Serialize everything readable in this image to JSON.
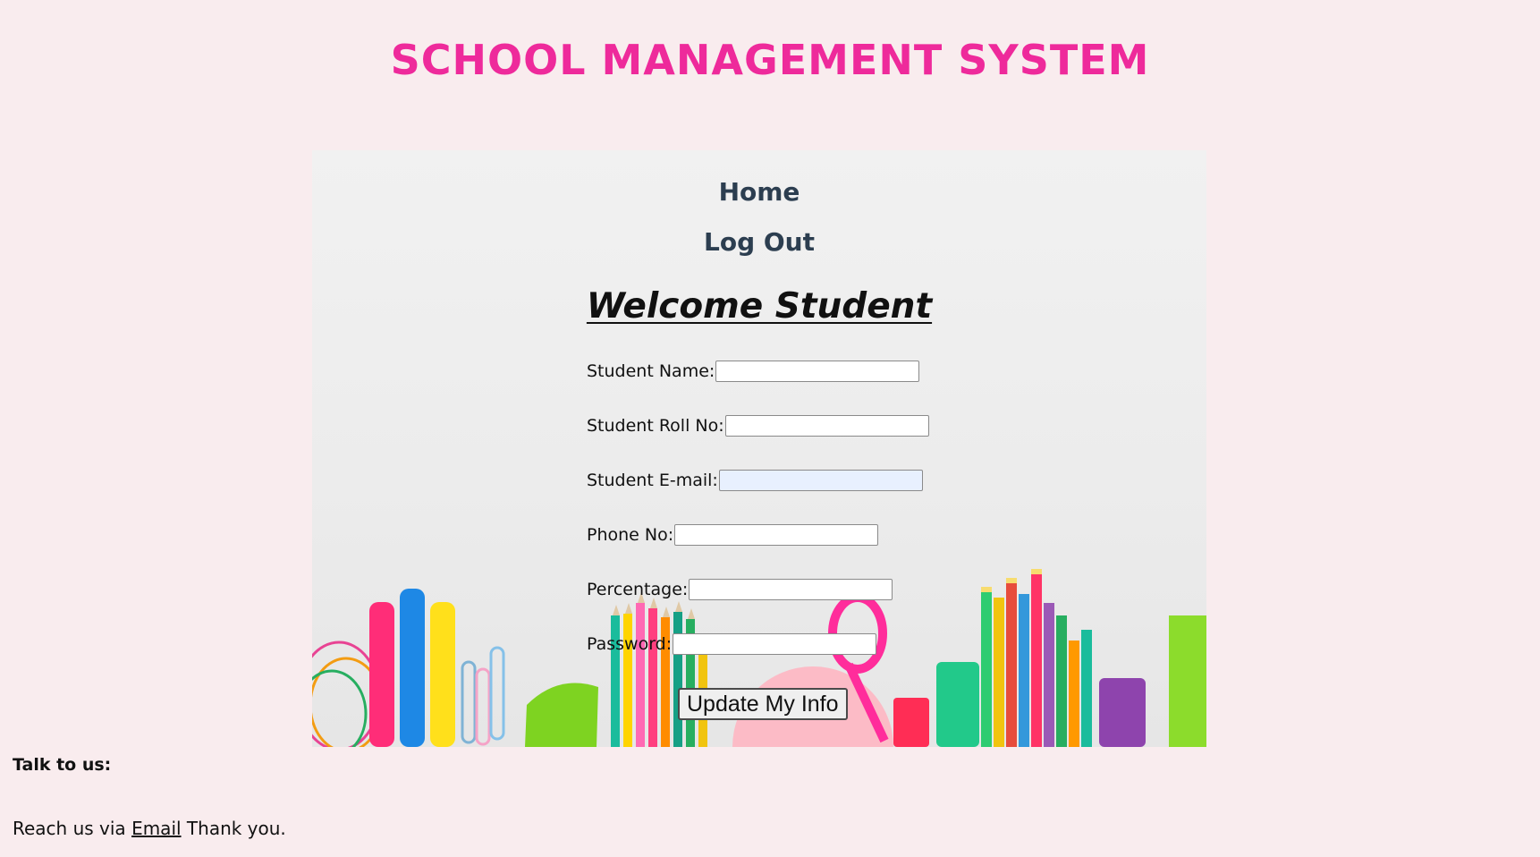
{
  "site": {
    "title": "SCHOOL MANAGEMENT SYSTEM"
  },
  "nav": {
    "home": "Home",
    "logout": "Log Out"
  },
  "heading": "Welcome Student",
  "form": {
    "fields": [
      {
        "label": "Student Name:",
        "value": ""
      },
      {
        "label": "Student Roll No:",
        "value": ""
      },
      {
        "label": "Student E-mail:",
        "value": ""
      },
      {
        "label": "Phone No:",
        "value": ""
      },
      {
        "label": "Percentage:",
        "value": ""
      },
      {
        "label": "Password:",
        "value": ""
      }
    ],
    "submit_label": "Update My Info"
  },
  "footer": {
    "title": "Talk to us:",
    "prefix": "Reach us via",
    "link_text": "Email",
    "suffix": "Thank you."
  },
  "colors": {
    "page_background": "#f9ecee",
    "title": "#ee2a9b",
    "nav": "#2c3e50",
    "email_field_autofill": "#e8f0fe"
  },
  "background_image": "school-supplies-illustration"
}
